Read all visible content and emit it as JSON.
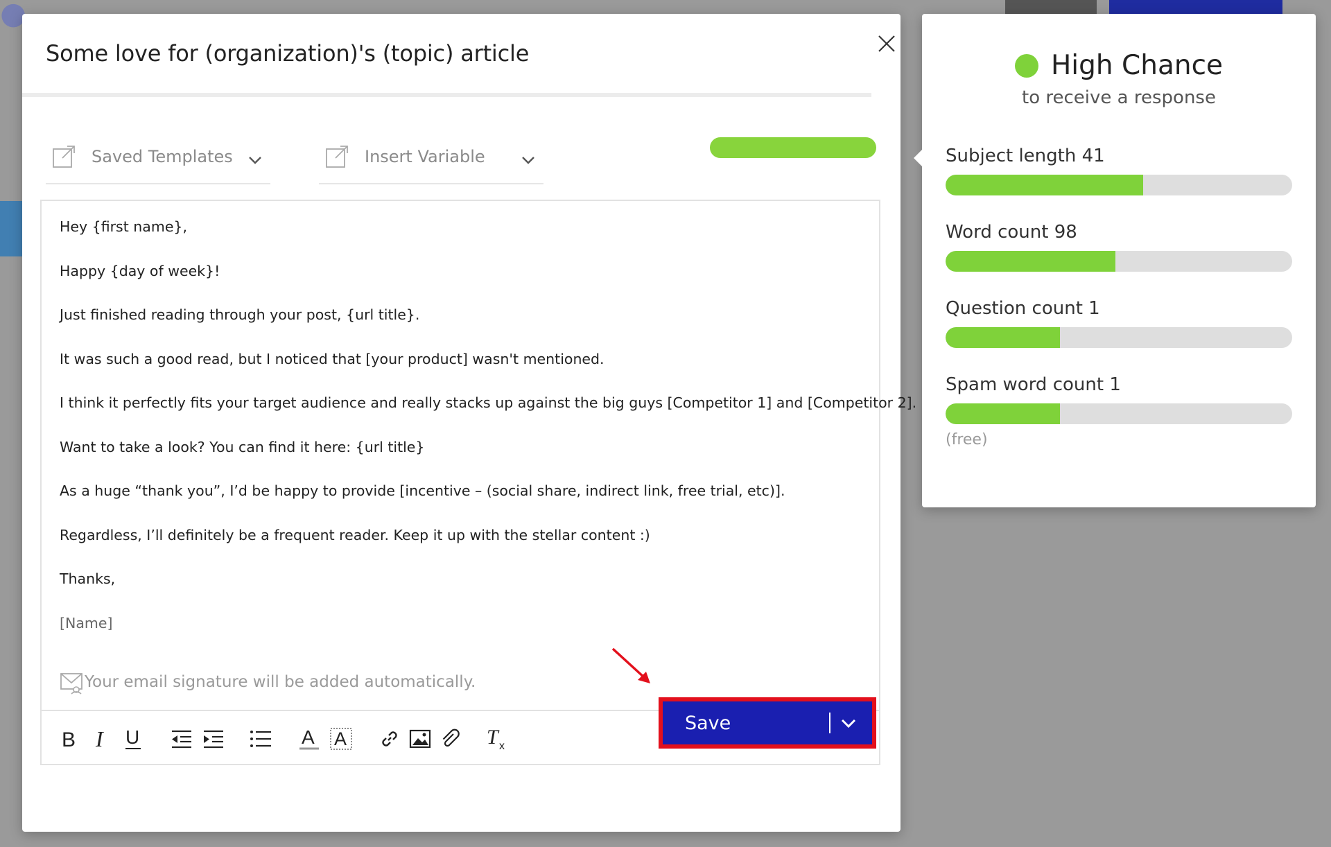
{
  "modal": {
    "title": "Some love for (organization)'s (topic) article",
    "saved_templates": "Saved Templates",
    "insert_variable": "Insert Variable",
    "body_lines": [
      "Hey {first name},",
      "Happy {day of week}!",
      "Just finished reading through your post, {url title}.",
      "It was such a good read, but I noticed that [your product] wasn't mentioned.",
      "I think it perfectly fits your target audience and really stacks up against the big guys [Competitor 1] and [Competitor 2].",
      "Want to take a look? You can find it here: {url title}",
      "As a huge “thank you”, I’d be happy to provide [incentive – (social share, indirect link, free trial, etc)].",
      "Regardless, I’ll definitely be a frequent reader. Keep it up with the stellar content :)",
      "Thanks,",
      "[Name]"
    ],
    "signature_note": "Your email signature will be added automatically.",
    "save_label": "Save"
  },
  "panel": {
    "chance_title": "High Chance",
    "chance_subtitle": "to receive a response",
    "metrics": [
      {
        "label": "Subject length 41",
        "level": 0.57
      },
      {
        "label": "Word count 98",
        "level": 0.49
      },
      {
        "label": "Question count 1",
        "level": 0.33
      },
      {
        "label": "Spam word count 1",
        "level": 0.33,
        "note": "(free)"
      }
    ]
  },
  "colors": {
    "accent_green": "#7fd23a",
    "save_blue": "#1a1fb0",
    "highlight_red": "#e3101c"
  },
  "toolbar_icons": [
    "bold-icon",
    "italic-icon",
    "underline-icon",
    "outdent-icon",
    "indent-icon",
    "bullet-list-icon",
    "text-color-icon",
    "highlight-color-icon",
    "link-icon",
    "image-icon",
    "attachment-icon",
    "clear-format-icon"
  ]
}
